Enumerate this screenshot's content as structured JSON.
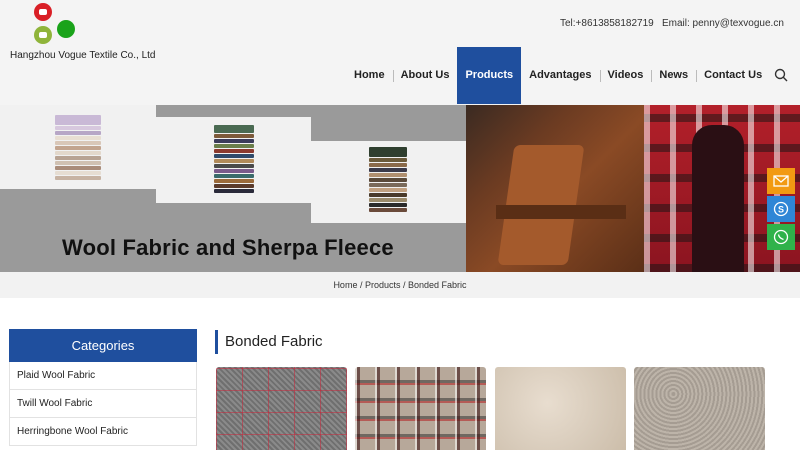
{
  "header": {
    "company": "Hangzhou Vogue Textile Co., Ltd",
    "tel": "Tel:+8613858182719",
    "email": "Email: penny@texvogue.cn"
  },
  "nav": {
    "items": [
      "Home",
      "About Us",
      "Products",
      "Advantages",
      "Videos",
      "News",
      "Contact Us"
    ],
    "active": "Products"
  },
  "banner": {
    "title": "Wool Fabric and Sherpa Fleece"
  },
  "breadcrumb": {
    "home": "Home",
    "sep1": " / ",
    "products": "Products",
    "sep2": " / ",
    "current": "Bonded Fabric"
  },
  "sidebar": {
    "heading": "Categories",
    "items": [
      "Plaid Wool Fabric",
      "Twill Wool Fabric",
      "Herringbone Wool Fabric"
    ]
  },
  "content": {
    "title": "Bonded Fabric"
  },
  "float_contact": {
    "icons": [
      "mail-icon",
      "skype-icon",
      "whatsapp-icon"
    ]
  },
  "colors": {
    "brand_blue": "#1f4f9e",
    "mail_orange": "#f29a12",
    "skype_blue": "#2f86d6",
    "whatsapp_green": "#2fb24a"
  }
}
